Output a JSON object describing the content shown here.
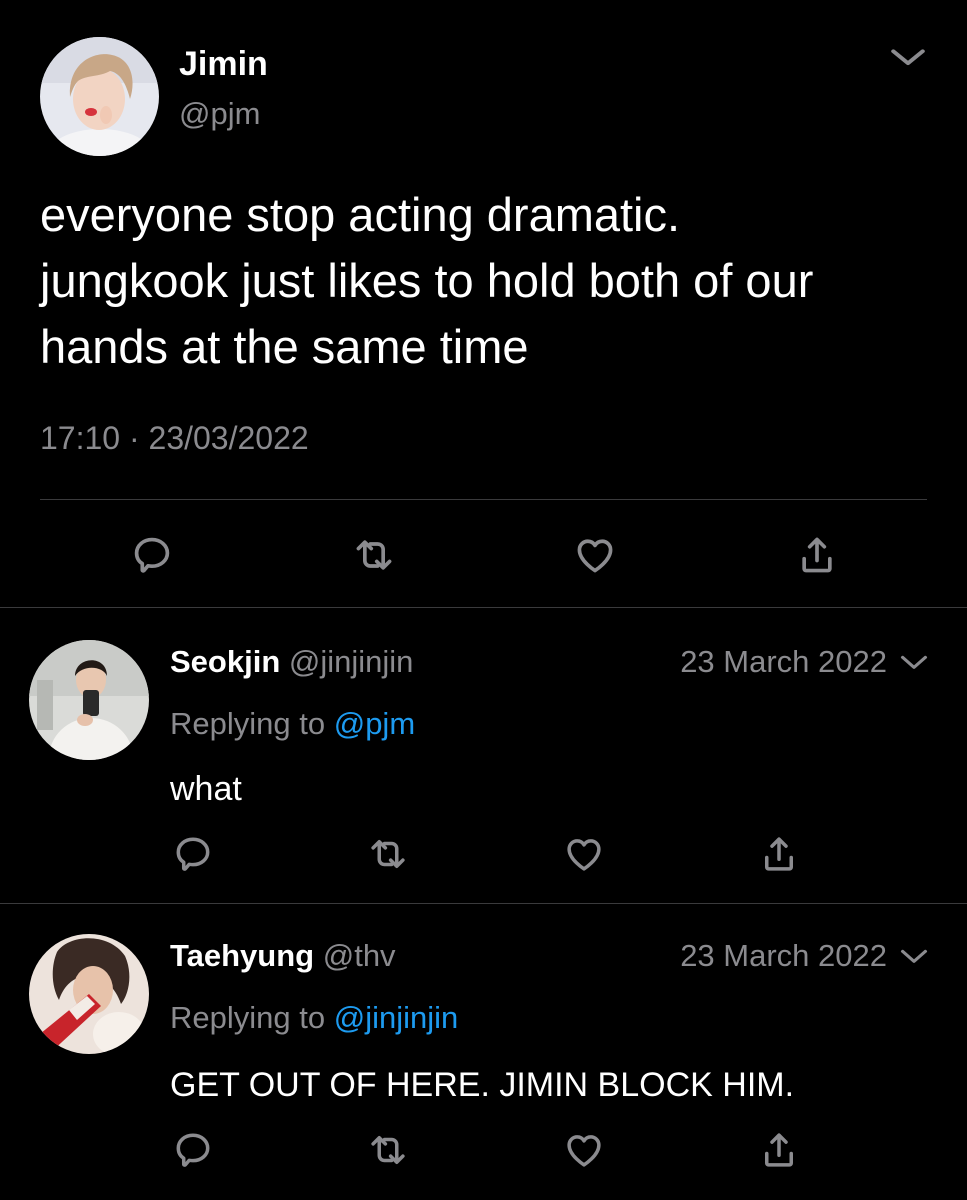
{
  "main_tweet": {
    "name": "Jimin",
    "handle": "@pjm",
    "text_lines": [
      "everyone stop acting dramatic.",
      "jungkook just likes to hold both of our",
      "hands at the same time"
    ],
    "time": "17:10",
    "separator": "·",
    "date": "23/03/2022",
    "avatar": "profile-photo-jimin",
    "icons": [
      "chevron-down-icon",
      "reply-icon",
      "retweet-icon",
      "like-icon",
      "share-icon"
    ]
  },
  "replies": [
    {
      "name": "Seokjin",
      "handle": "@jinjinjin",
      "date": "23 March 2022",
      "replying_prefix": "Replying to",
      "replying_to": "@pjm",
      "text": "what",
      "avatar": "profile-photo-seokjin"
    },
    {
      "name": "Taehyung",
      "handle": "@thv",
      "date": "23 March 2022",
      "replying_prefix": "Replying to",
      "replying_to": "@jinjinjin",
      "text": "GET OUT OF HERE. JIMIN BLOCK HIM.",
      "avatar": "profile-photo-taehyung"
    }
  ],
  "colors": {
    "background": "#000000",
    "text": "#ffffff",
    "secondary": "#8b8b8f",
    "mention": "#1d9bf0",
    "icon": "#8b8b8f",
    "divider": "#3a3a3c"
  }
}
